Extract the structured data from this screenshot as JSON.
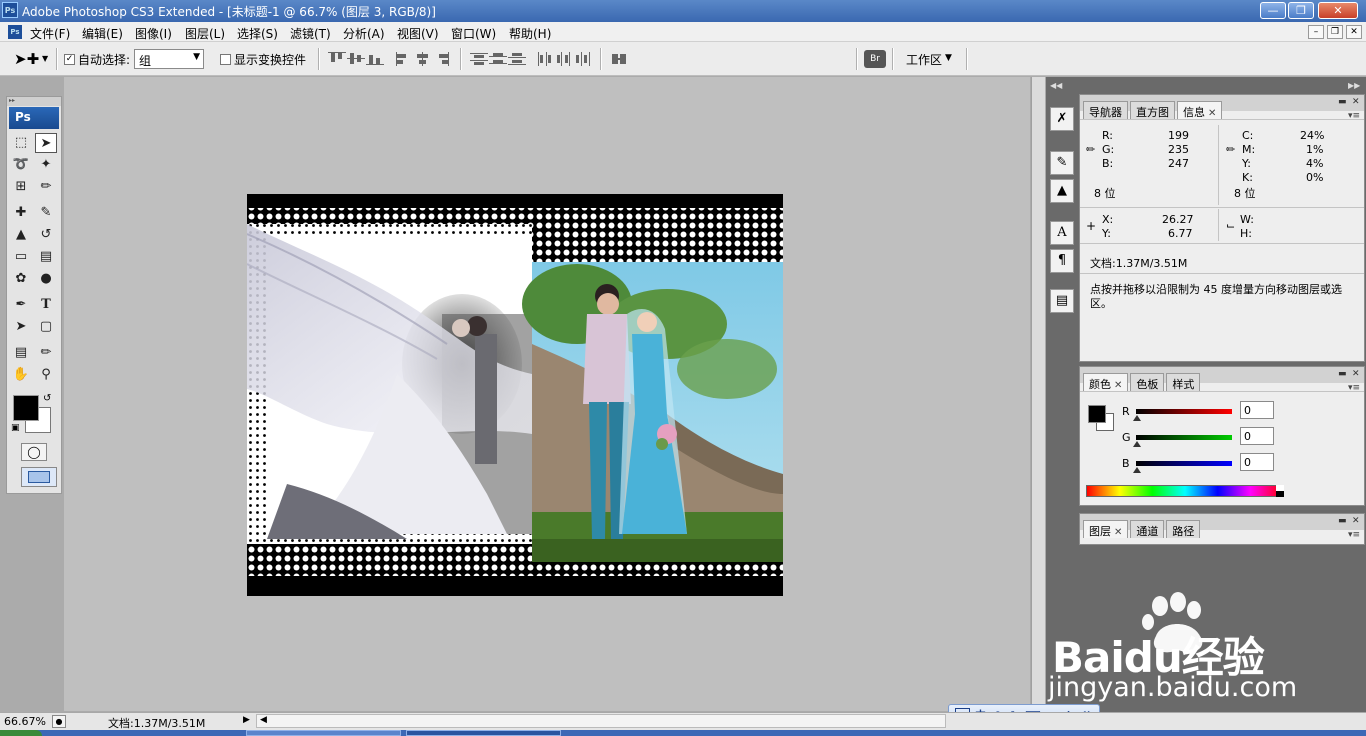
{
  "window": {
    "title": "Adobe Photoshop CS3 Extended - [未标题-1 @ 66.7% (图层 3, RGB/8)]",
    "app_badge": "Ps"
  },
  "menu": {
    "items": [
      "文件(F)",
      "编辑(E)",
      "图像(I)",
      "图层(L)",
      "选择(S)",
      "滤镜(T)",
      "分析(A)",
      "视图(V)",
      "窗口(W)",
      "帮助(H)"
    ]
  },
  "options": {
    "auto_select_label": "自动选择:",
    "auto_select_checked": true,
    "auto_select_value": "组",
    "show_transform_label": "显示变换控件",
    "show_transform_checked": false,
    "workspace_label": "工作区"
  },
  "toolbox": {
    "logo": "Ps"
  },
  "panels": {
    "info_tabs": [
      "导航器",
      "直方图",
      "信息"
    ],
    "info_active_tab": "信息",
    "rgb": {
      "r_label": "R:",
      "g_label": "G:",
      "b_label": "B:",
      "r": "199",
      "g": "235",
      "b": "247",
      "bits": "8 位"
    },
    "cmyk": {
      "c_label": "C:",
      "m_label": "M:",
      "y_label": "Y:",
      "k_label": "K:",
      "c": "24%",
      "m": "1%",
      "y": "4%",
      "k": "0%",
      "bits": "8 位"
    },
    "coords": {
      "x_label": "X:",
      "y_label": "Y:",
      "x": "26.27",
      "y": "6.77",
      "w_label": "W:",
      "h_label": "H:"
    },
    "doc_size": "文档:1.37M/3.51M",
    "hint": "点按并拖移以沿限制为 45 度增量方向移动图层或选区。",
    "color_tabs": [
      "颜色",
      "色板",
      "样式"
    ],
    "color": {
      "r_label": "R",
      "g_label": "G",
      "b_label": "B",
      "r": "0",
      "g": "0",
      "b": "0"
    },
    "layer_tabs": [
      "图层",
      "通道",
      "路径"
    ]
  },
  "status": {
    "zoom": "66.67%",
    "doc_size": "文档:1.37M/3.51M"
  },
  "ime": {
    "mode": "中"
  },
  "watermark": {
    "brand": "Baidu经验",
    "url": "jingyan.baidu.com"
  },
  "colors": {
    "foreground": "#000000",
    "background": "#ffffff",
    "titlebar": "#4a78c0",
    "photo_sky": "#9ad6ec",
    "photo_grass": "#4a7a2a",
    "dress_blue": "#4ab2d8"
  }
}
